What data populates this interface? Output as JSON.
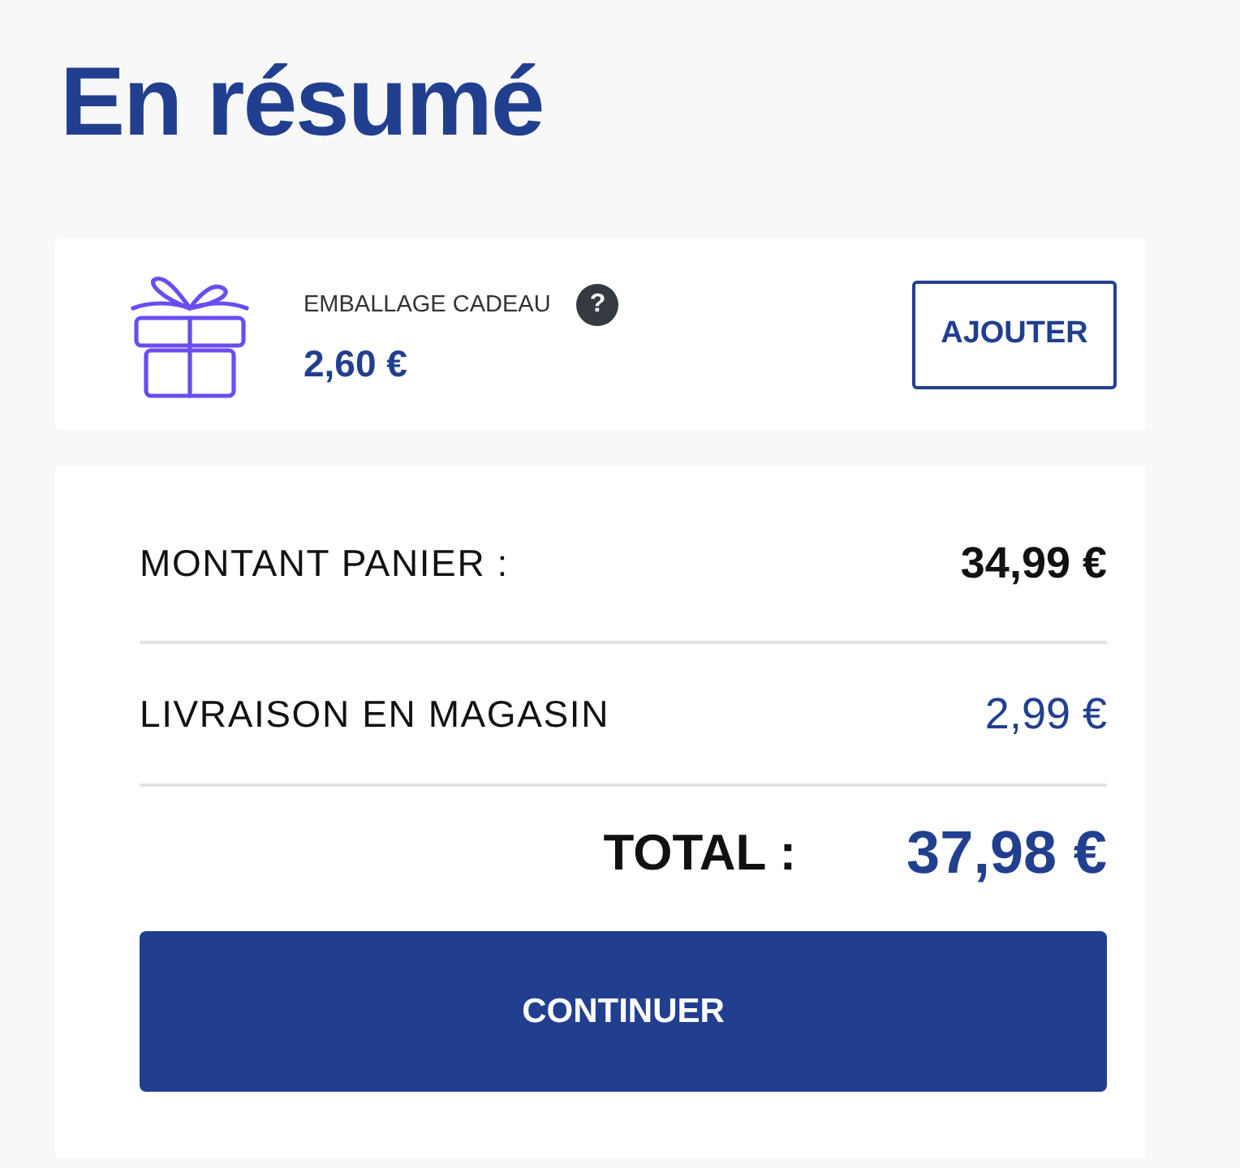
{
  "title": "En résumé",
  "gift_wrap": {
    "label": "EMBALLAGE CADEAU",
    "help": "?",
    "price": "2,60 €",
    "button": "AJOUTER"
  },
  "summary": {
    "lines": [
      {
        "kind": "subtotal",
        "label": "MONTANT PANIER :",
        "amount": "34,99 €"
      },
      {
        "kind": "shipping",
        "label": "LIVRAISON EN MAGASIN",
        "amount": "2,99 €"
      }
    ],
    "total": {
      "label": "TOTAL :",
      "amount": "37,98 €"
    },
    "button": "CONTINUER"
  }
}
